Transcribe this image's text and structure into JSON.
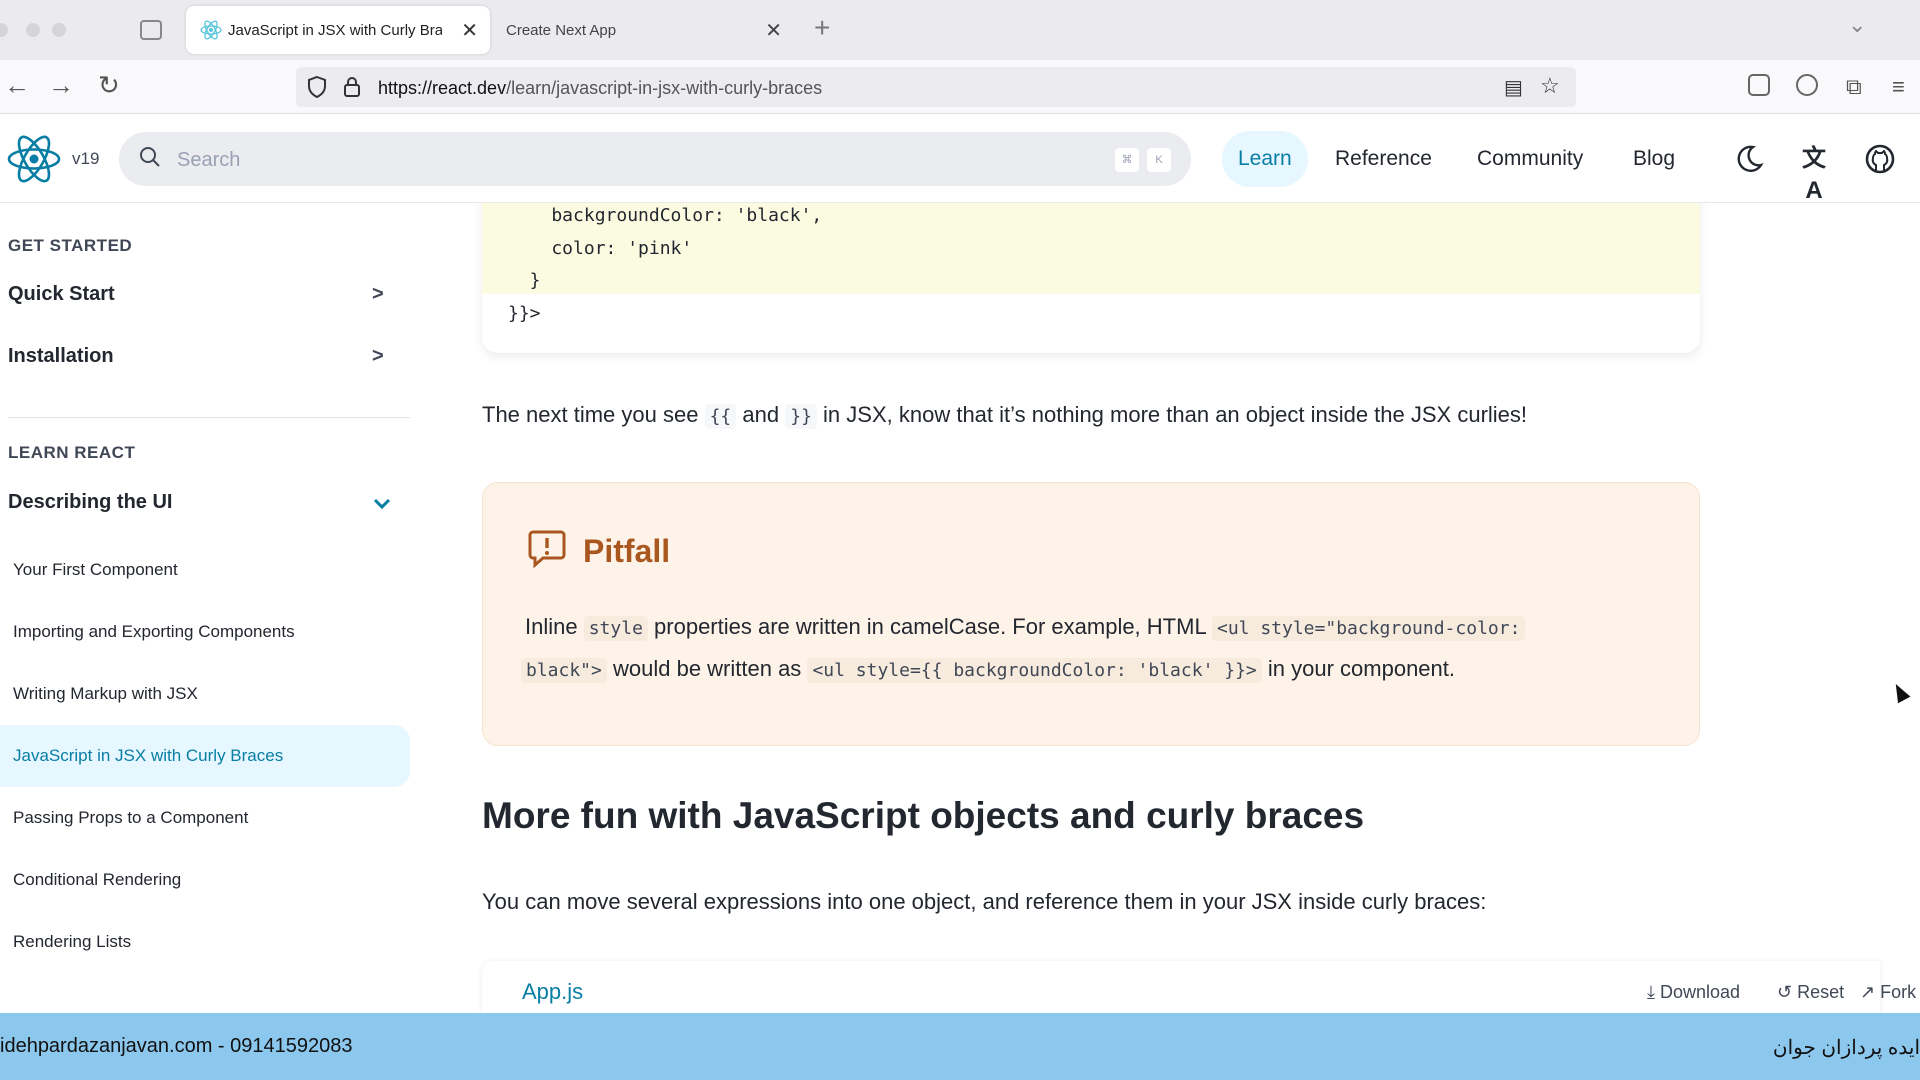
{
  "browser": {
    "tabs": [
      {
        "title": "JavaScript in JSX with Curly Bra",
        "active": true
      },
      {
        "title": "Create Next App",
        "active": false
      }
    ],
    "url_host": "https://react.dev",
    "url_path": "/learn/javascript-in-jsx-with-curly-braces"
  },
  "header": {
    "version": "v19",
    "search_placeholder": "Search",
    "shortcut_cmd": "⌘",
    "shortcut_key": "K",
    "nav": [
      "Learn",
      "Reference",
      "Community",
      "Blog"
    ]
  },
  "sidebar": {
    "section_get_started": "GET STARTED",
    "quick_start": "Quick Start",
    "installation": "Installation",
    "section_learn": "LEARN REACT",
    "describing_ui": "Describing the UI",
    "items": [
      "Your First Component",
      "Importing and Exporting Components",
      "Writing Markup with JSX",
      "JavaScript in JSX with Curly Braces",
      "Passing Props to a Component",
      "Conditional Rendering",
      "Rendering Lists"
    ],
    "active_item": "JavaScript in JSX with Curly Braces"
  },
  "main": {
    "code_lines": [
      "    backgroundColor: 'black',",
      "    color: 'pink'",
      "  }",
      "}}>"
    ],
    "para1_a": "The next time you see",
    "para1_code1": "{{",
    "para1_b": "and",
    "para1_code2": "}}",
    "para1_c": "in JSX, know that it’s nothing more than an object inside the JSX curlies!",
    "pitfall_title": "Pitfall",
    "pitfall_l1_a": "Inline",
    "pitfall_l1_code1": "style",
    "pitfall_l1_b": "properties are written in camelCase. For example, HTML",
    "pitfall_l1_code2": "<ul style=\"background-color:",
    "pitfall_l2_code1": "black\">",
    "pitfall_l2_a": "would be written as",
    "pitfall_l2_code2": "<ul style={{ backgroundColor: 'black' }}>",
    "pitfall_l2_b": "in your component.",
    "heading": "More fun with JavaScript objects and curly braces",
    "para2": "You can move several expressions into one object, and reference them in your JSX inside curly braces:",
    "sandbox_file": "App.js",
    "sandbox_download": "Download",
    "sandbox_reset": "Reset",
    "sandbox_fork": "Fork"
  },
  "watermark": {
    "left": "idehpardazanjavan.com - 09141592083",
    "right": "ایده پردازان جوان"
  },
  "colors": {
    "accent": "#087ea4",
    "pitfall_bg": "#fdf3e8",
    "pitfall_title": "#a9571f",
    "code_highlight": "#fbfbe2",
    "watermark_bar": "#8cc7ee"
  }
}
